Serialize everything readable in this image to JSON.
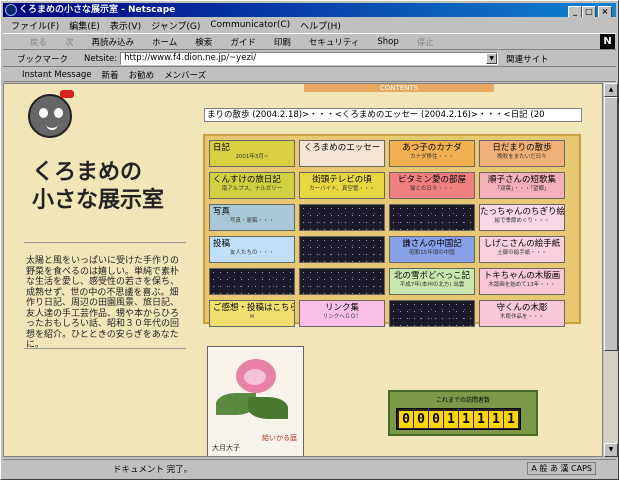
{
  "window": {
    "title": "くろまめの小さな展示室 - Netscape",
    "buttons": [
      "_",
      "□",
      "×"
    ]
  },
  "menu": [
    "ファイル(F)",
    "編集(E)",
    "表示(V)",
    "ジャンプ(G)",
    "Communicator(C)",
    "ヘルプ(H)"
  ],
  "toolbar": {
    "buttons": [
      {
        "label": "戻る",
        "enabled": false
      },
      {
        "label": "次",
        "enabled": false
      },
      {
        "label": "再読み込み",
        "enabled": true
      },
      {
        "label": "ホーム",
        "enabled": true
      },
      {
        "label": "検索",
        "enabled": true
      },
      {
        "label": "ガイド",
        "enabled": true
      },
      {
        "label": "印刷",
        "enabled": true
      },
      {
        "label": "セキュリティ",
        "enabled": true
      },
      {
        "label": "Shop",
        "enabled": true
      },
      {
        "label": "停止",
        "enabled": false
      }
    ],
    "logo": "N"
  },
  "location": {
    "bookmark": "ブックマーク",
    "label": "Netsite:",
    "url": "http://www.f4.dion.ne.jp/~yezi/",
    "related": "関連サイト"
  },
  "personal": [
    "Instant Message",
    "新着",
    "お勧め",
    "メンバーズ"
  ],
  "page": {
    "contents_header": "CONTENTS",
    "brand": [
      "くろまめの",
      "小さな展示室"
    ],
    "description": "太陽と風をいっぱいに受けた手作りの野菜を食べるのは嬉しい。単純で素朴な生活を愛し、感受性の若さを保ち、成熟せず、世の中の不思議を喜ぶ。畑作り日記、周辺の田園風景、旅日記、友人達の手工芸作品、甥や本からひろったおもしろい話、昭和３０年代の回想を紹介。ひとときの安らぎをあなたに。",
    "marquee": "まりの散歩 (2004.2.18)>・・・<くろまめのエッセー (2004.2.16)>・・・<日記 (20",
    "grid": [
      {
        "title": "日記",
        "sub": "2001年3月~",
        "bg": "#d8d040"
      },
      {
        "title": "くろまめのエッセー",
        "sub": "",
        "bg": "#f4e4d4"
      },
      {
        "title": "あつ子のカナダ",
        "sub": "カナダ移住・・・",
        "bg": "#f0b050"
      },
      {
        "title": "日だまりの散歩",
        "sub": "晩秋をまたいだ日々",
        "bg": "#f0b078"
      },
      {
        "title": "くんすけの旅日記",
        "sub": "南アルプス、ナルガリー",
        "bg": "#d0d040"
      },
      {
        "title": "街頭テレビの頃",
        "sub": "カーバイト、真空管・・・",
        "bg": "#e8d840"
      },
      {
        "title": "ビタミン愛の部屋",
        "sub": "猫との日々・・・",
        "bg": "#f08080"
      },
      {
        "title": "順子さんの短歌集",
        "sub": "「双葉」・・・「望郷」",
        "bg": "#f4b0b8"
      },
      {
        "title": "写真",
        "sub": "写真・原稿・・・",
        "bg": "#a8c8d8"
      },
      {
        "title": "",
        "sub": "",
        "bg": "dark"
      },
      {
        "title": "",
        "sub": "",
        "bg": "dark"
      },
      {
        "title": "たっちゃんのちぎり絵",
        "sub": "絵で季節めぐり・・・",
        "bg": "#f8d8e8"
      },
      {
        "title": "投稿",
        "sub": "友人たちの・・・",
        "bg": "#c0e0f8"
      },
      {
        "title": "",
        "sub": "",
        "bg": "dark"
      },
      {
        "title": "謙さんの中国記",
        "sub": "昭和15年頃の中国",
        "bg": "#88a0e8"
      },
      {
        "title": "しげこさんの絵手紙",
        "sub": "土御の絵手紙・・・",
        "bg": "#f8d0e0"
      },
      {
        "title": "",
        "sub": "",
        "bg": "dark"
      },
      {
        "title": "",
        "sub": "",
        "bg": "dark"
      },
      {
        "title": "北の雪ボどべっこ記",
        "sub": "平成7年(本州の北方) 出雲",
        "bg": "#c8e8b0"
      },
      {
        "title": "トキちゃんの木版画",
        "sub": "木版画を始めて13年・・・",
        "bg": "#f8c8d8"
      },
      {
        "title": "ご感想・投稿はこちらへ",
        "sub": "✉",
        "bg": "#f0e070"
      },
      {
        "title": "リンク集",
        "sub": "リンクへＧＯ！",
        "bg": "#f8c0e8"
      },
      {
        "title": "",
        "sub": "",
        "bg": "dark"
      },
      {
        "title": "守くんの木彫",
        "sub": "木彫作品を・・・",
        "bg": "#f8c8d8"
      }
    ],
    "photo": {
      "caption": "大月大子",
      "caption2": "給いかる庭"
    },
    "counter": {
      "label": "これまでの訪問者数",
      "digits": [
        "0",
        "0",
        "0",
        "1",
        "1",
        "1",
        "1",
        "1"
      ]
    }
  },
  "status": {
    "text": "ドキュメント 完了。",
    "ime": "A 般 あ 漢 CAPS"
  }
}
